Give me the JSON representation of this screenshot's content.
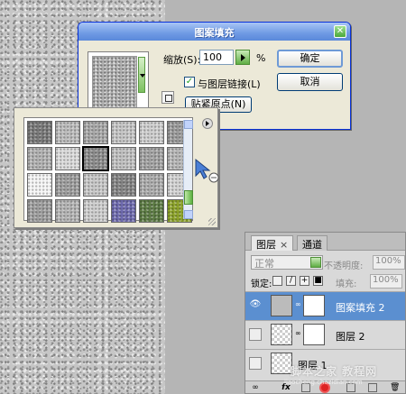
{
  "dialog": {
    "title": "图案填充",
    "scale_label": "缩放(S):",
    "scale_value": "100",
    "percent": "%",
    "link_label": "与图层链接(L)",
    "link_checked": true,
    "snap_origin_label": "贴紧原点(N)",
    "ok_label": "确定",
    "cancel_label": "取消",
    "close_glyph": "✕"
  },
  "picker": {
    "swatches": [
      {
        "color": "#7a7a7a"
      },
      {
        "color": "#bdbdbd"
      },
      {
        "color": "#a9a9a9"
      },
      {
        "color": "#c7c7c7"
      },
      {
        "color": "#d0d0d0"
      },
      {
        "color": "#9c9c9c"
      },
      {
        "color": "#b3b3b3"
      },
      {
        "color": "#dcdcdc"
      },
      {
        "color": "#8d8d8d",
        "selected": true
      },
      {
        "color": "#c2c2c2"
      },
      {
        "color": "#a4a4a4"
      },
      {
        "color": "#b8b8b8"
      },
      {
        "color": "#f7f7f7"
      },
      {
        "color": "#9f9f9f"
      },
      {
        "color": "#c9c9c9"
      },
      {
        "color": "#858585"
      },
      {
        "color": "#adadad"
      },
      {
        "color": "#d5d5d5"
      },
      {
        "color": "#a0a0a0"
      },
      {
        "color": "#b6b6b6"
      },
      {
        "color": "#cfcfcf"
      },
      {
        "color": "#6f6bb0"
      },
      {
        "color": "#5e7d45"
      },
      {
        "color": "#8ea42a"
      }
    ]
  },
  "layers": {
    "tab_layers": "图层",
    "tab_close": "×",
    "tab_channels": "通道",
    "blend_mode": "正常",
    "opacity_label": "不透明度:",
    "opacity_value": "100%",
    "lock_label": "锁定:",
    "fill_label": "填充:",
    "fill_value": "100%",
    "rows": [
      {
        "name": "图案填充 2",
        "visible": true,
        "selected": true
      },
      {
        "name": "图层 2",
        "visible": false
      },
      {
        "name": "图层 1",
        "visible": false
      }
    ],
    "eye_glyph": "👁",
    "fx_label": "fx"
  },
  "watermark": {
    "text": "脚本之家 教程网",
    "url": "jiaocheng.chazidian.com"
  }
}
